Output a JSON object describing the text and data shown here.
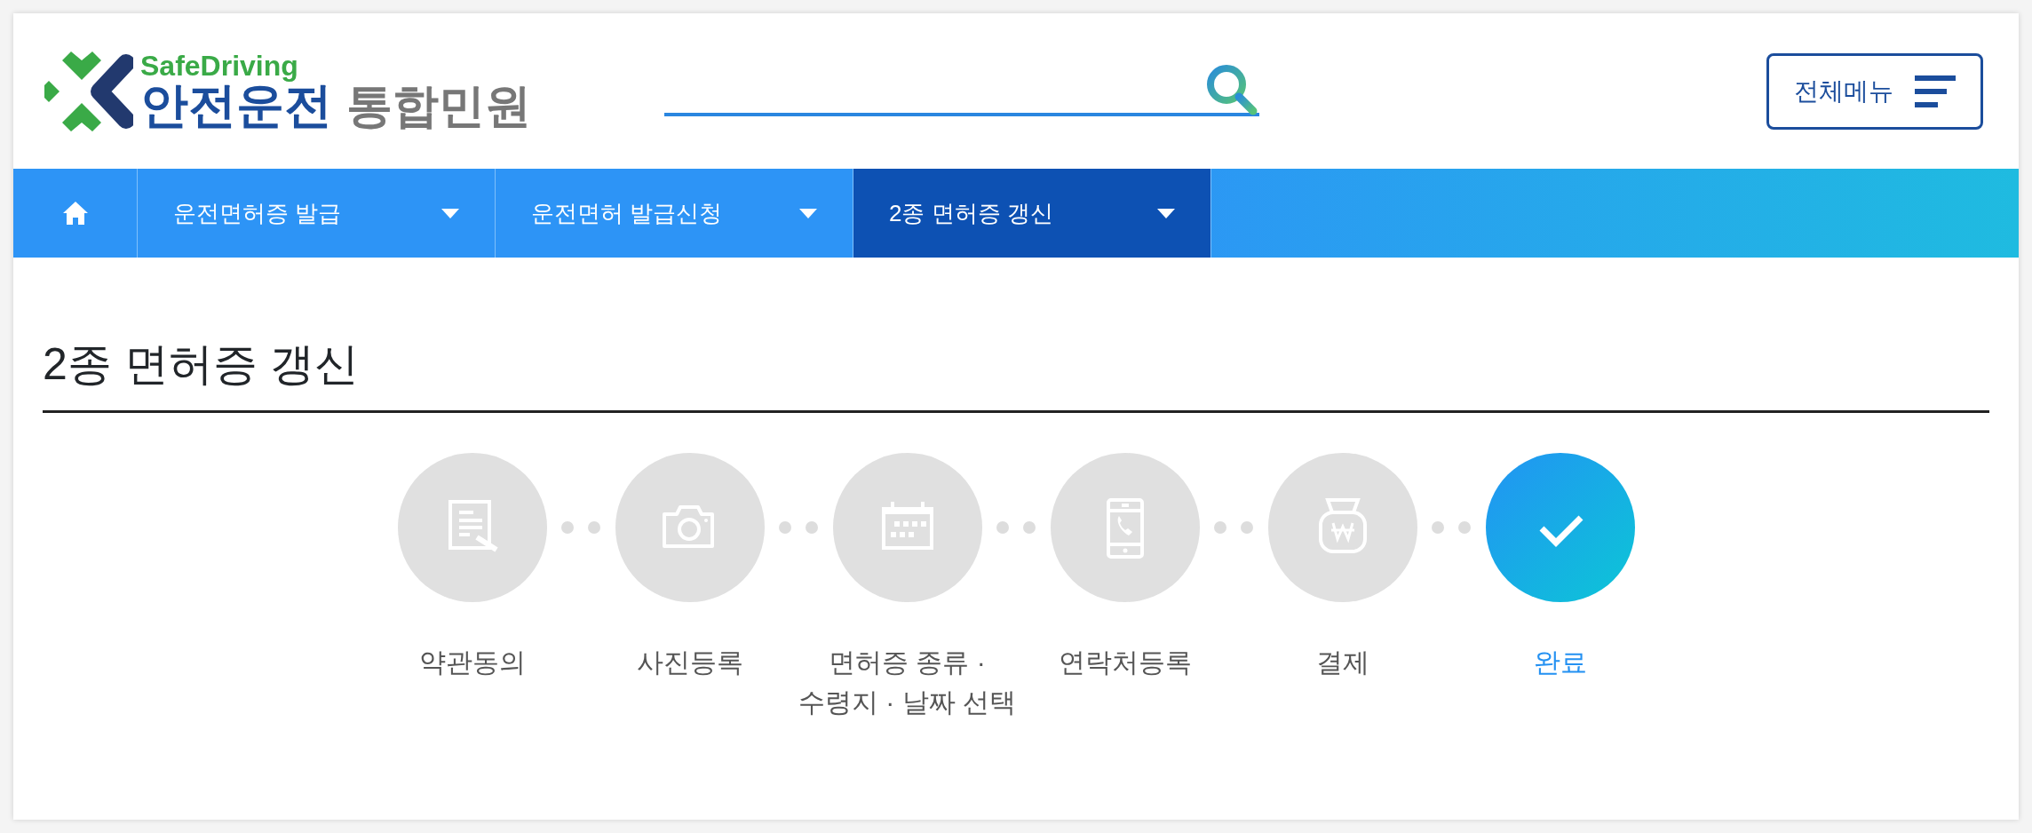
{
  "header": {
    "logo": {
      "tagline": "SafeDriving",
      "name": "안전운전",
      "suffix": "통합민원"
    },
    "menu_button": "전체메뉴"
  },
  "breadcrumb": [
    {
      "label": "운전면허증 발급",
      "selected": false
    },
    {
      "label": "운전면허 발급신청",
      "selected": false
    },
    {
      "label": "2종 면허증 갱신",
      "selected": true
    }
  ],
  "title": "2종 면허증 갱신",
  "steps": [
    {
      "label": "약관동의",
      "selected": false
    },
    {
      "label": "사진등록",
      "selected": false
    },
    {
      "label": "면허증 종류 ·\n수령지 · 날짜 선택",
      "selected": false
    },
    {
      "label": "연락처등록",
      "selected": false
    },
    {
      "label": "결제",
      "selected": false
    },
    {
      "label": "완료",
      "selected": true
    }
  ]
}
